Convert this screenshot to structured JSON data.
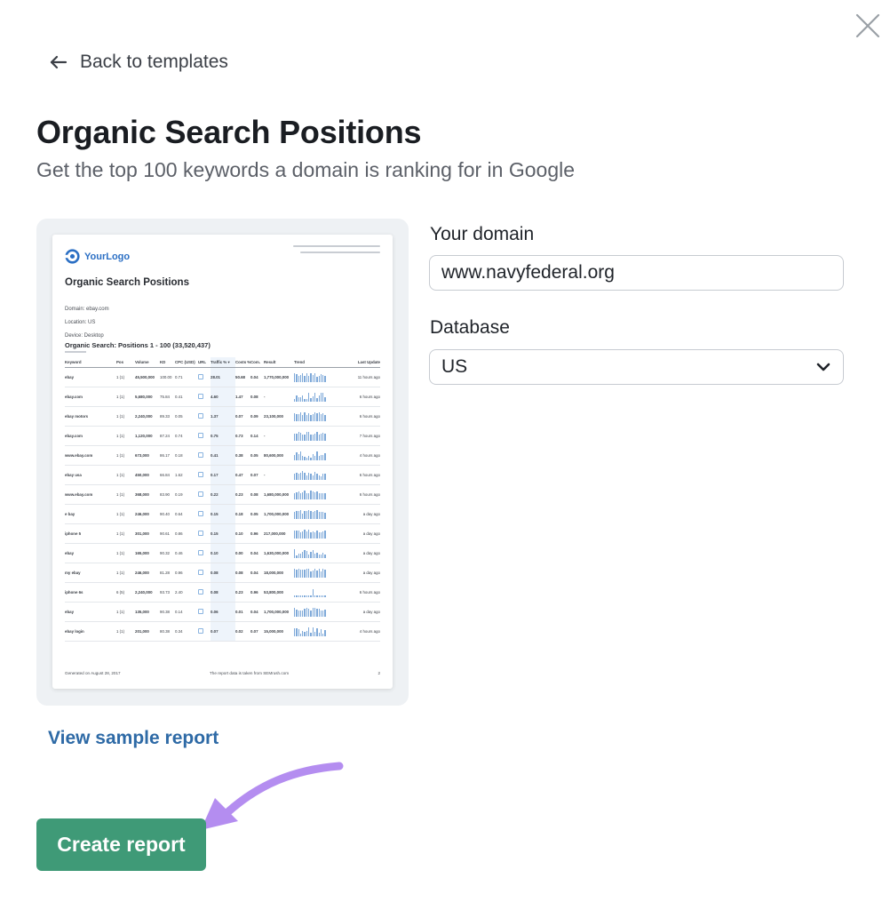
{
  "modal": {
    "close_icon": "close-icon",
    "back": {
      "icon": "arrow-left-icon",
      "label": "Back to templates"
    },
    "title": "Organic Search Positions",
    "subtitle": "Get the top 100 keywords a domain is ranking for in Google"
  },
  "preview": {
    "logo_text": "YourLogo",
    "title": "Organic Search Positions",
    "meta": [
      "Domain: ebay.com",
      "Location: US",
      "Device: Desktop"
    ],
    "section_title": "Organic Search: Positions 1 - 100 (33,520,437)",
    "columns": [
      "Keyword",
      "Pos",
      "Volume",
      "KD",
      "CPC (USD)",
      "URL",
      "Traffic % ▾",
      "Costs %",
      "Com.",
      "Result",
      "Trend",
      "Last Update"
    ],
    "rows": [
      {
        "keyword": "ebay",
        "pos": "1 (1)",
        "volume": "45,500,000",
        "kd": "100.00",
        "cpc": "0.71",
        "traffic": "28.01",
        "costs": "50.68",
        "com": "0.04",
        "result": "1,770,000,000",
        "update": "11 hours ago"
      },
      {
        "keyword": "ebay.com",
        "pos": "1 (1)",
        "volume": "5,680,000",
        "kd": "75.84",
        "cpc": "0.41",
        "traffic": "4.60",
        "costs": "1.47",
        "com": "0.08",
        "result": "-",
        "update": "6 hours ago"
      },
      {
        "keyword": "ebay motors",
        "pos": "1 (1)",
        "volume": "2,240,000",
        "kd": "89.33",
        "cpc": "0.05",
        "traffic": "1.37",
        "costs": "0.07",
        "com": "0.09",
        "result": "23,100,000",
        "update": "6 hours ago"
      },
      {
        "keyword": "ebay.com",
        "pos": "1 (1)",
        "volume": "1,120,000",
        "kd": "87.24",
        "cpc": "0.74",
        "traffic": "0.75",
        "costs": "0.73",
        "com": "0.14",
        "result": "-",
        "update": "7 hours ago"
      },
      {
        "keyword": "www.ebay.com",
        "pos": "1 (1)",
        "volume": "673,000",
        "kd": "86.17",
        "cpc": "0.18",
        "traffic": "0.41",
        "costs": "0.38",
        "com": "0.05",
        "result": "80,600,000",
        "update": "4 hours ago"
      },
      {
        "keyword": "ebay usa",
        "pos": "1 (1)",
        "volume": "450,000",
        "kd": "66.84",
        "cpc": "1.62",
        "traffic": "0.17",
        "costs": "0.47",
        "com": "0.07",
        "result": "-",
        "update": "6 hours ago"
      },
      {
        "keyword": "www.ebay.com",
        "pos": "1 (1)",
        "volume": "368,000",
        "kd": "83.90",
        "cpc": "0.19",
        "traffic": "0.22",
        "costs": "0.23",
        "com": "0.08",
        "result": "1,680,000,000",
        "update": "6 hours ago"
      },
      {
        "keyword": "e bay",
        "pos": "1 (1)",
        "volume": "246,000",
        "kd": "90.40",
        "cpc": "0.64",
        "traffic": "0.15",
        "costs": "0.18",
        "com": "0.05",
        "result": "1,700,000,000",
        "update": "a day ago"
      },
      {
        "keyword": "iphone 5",
        "pos": "1 (1)",
        "volume": "301,000",
        "kd": "90.61",
        "cpc": "0.86",
        "traffic": "0.15",
        "costs": "0.10",
        "com": "0.96",
        "result": "217,000,000",
        "update": "a day ago"
      },
      {
        "keyword": "ebay",
        "pos": "1 (1)",
        "volume": "165,000",
        "kd": "90.32",
        "cpc": "0.46",
        "traffic": "0.10",
        "costs": "0.00",
        "com": "0.04",
        "result": "1,630,000,000",
        "update": "a day ago"
      },
      {
        "keyword": "my ebay",
        "pos": "1 (1)",
        "volume": "246,000",
        "kd": "81.28",
        "cpc": "0.96",
        "traffic": "0.08",
        "costs": "0.08",
        "com": "0.04",
        "result": "18,000,000",
        "update": "a day ago"
      },
      {
        "keyword": "iphone 6s",
        "pos": "6 (5)",
        "volume": "2,240,000",
        "kd": "93.73",
        "cpc": "2.40",
        "traffic": "0.08",
        "costs": "0.23",
        "com": "0.96",
        "result": "53,800,000",
        "update": "6 hours ago"
      },
      {
        "keyword": "ebay",
        "pos": "1 (1)",
        "volume": "135,000",
        "kd": "90.38",
        "cpc": "0.14",
        "traffic": "0.06",
        "costs": "0.01",
        "com": "0.04",
        "result": "1,700,000,000",
        "update": "a day ago"
      },
      {
        "keyword": "ebay login",
        "pos": "1 (1)",
        "volume": "201,000",
        "kd": "80.38",
        "cpc": "0.34",
        "traffic": "0.07",
        "costs": "0.02",
        "com": "0.07",
        "result": "15,000,000",
        "update": "4 hours ago"
      }
    ],
    "footer_left": "Generated on August 28, 2017",
    "footer_center": "The report data is taken from SEMrush.com",
    "footer_right": "2"
  },
  "form": {
    "domain_label": "Your domain",
    "domain_value": "www.navyfederal.org",
    "database_label": "Database",
    "database_value": "US",
    "database_icon": "chevron-down-icon"
  },
  "links": {
    "view_sample": "View sample report"
  },
  "actions": {
    "create": "Create report"
  },
  "annotation": {
    "icon": "curved-arrow-icon",
    "color": "#b48df0"
  },
  "colors": {
    "primary_button": "#3f9a77",
    "link": "#2e6aa6",
    "logo": "#2b6fc4"
  }
}
